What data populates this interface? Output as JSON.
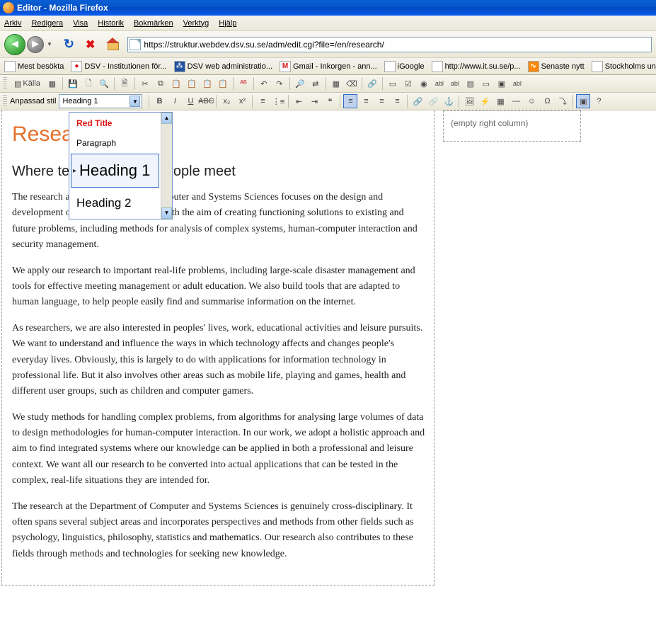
{
  "window": {
    "title": "Editor - Mozilla Firefox"
  },
  "menu": {
    "arkiv": "Arkiv",
    "redigera": "Redigera",
    "visa": "Visa",
    "historik": "Historik",
    "bokmark": "Bokmärken",
    "verktyg": "Verktyg",
    "hjalp": "Hjälp"
  },
  "url": "https://struktur.webdev.dsv.su.se/adm/edit.cgi?file=/en/research/",
  "bookmarks": {
    "b1": "Mest besökta",
    "b2": "DSV - Institutionen för...",
    "b3": "DSV web administratio...",
    "b4": "Gmail - Inkorgen - ann...",
    "b5": "iGoogle",
    "b6": "http://www.it.su.se/p...",
    "b7": "Senaste nytt",
    "b8": "Stockholms univers"
  },
  "toolbar1": {
    "kalla": "Källa"
  },
  "toolbar2": {
    "anpassad": "Anpassad stil",
    "style_value": "Heading 1"
  },
  "style_popup": {
    "red": "Red Title",
    "para": "Paragraph",
    "h1": "Heading 1",
    "h2": "Heading 2"
  },
  "doc": {
    "h1": "Research",
    "h2": "Where technology and people meet",
    "p1": "The research at the Department of Computer and Systems Sciences focuses on the design and development of information systems, with the aim of creating functioning solutions to existing and future problems, including methods for analysis of complex systems, human-computer interaction and security management.",
    "p2": "We apply our research to important real-life problems, including large-scale disaster management and tools for effective meeting management or adult education. We also build tools that are adapted to human language, to help people easily find and summarise information on the internet.",
    "p3": "As researchers, we are also interested in peoples' lives, work, educational activities and leisure pursuits. We want to understand and influence the ways in which technology affects and changes people's everyday lives. Obviously, this is largely to do with applications for information technology in professional life. But it also involves other areas such as mobile life, playing and games, health and different user groups, such as children and computer gamers.",
    "p4": "We study methods for handling complex problems, from algorithms for analysing large volumes of data to design methodologies for human-computer interaction. In our work, we adopt a holistic approach and aim to find integrated systems where our knowledge can be applied in both a professional and leisure context. We want all our research to be converted into actual applications that can be tested in the complex, real-life situations they are intended for.",
    "p5": "The research at the Department of Computer and Systems Sciences is genuinely cross-disciplinary. It often spans several subject areas and incorporates perspectives and methods from other fields such as psychology, linguistics, philosophy, statistics and mathematics. Our research also contributes to these fields through methods and technologies for seeking new knowledge."
  },
  "right_col": "(empty right column)"
}
